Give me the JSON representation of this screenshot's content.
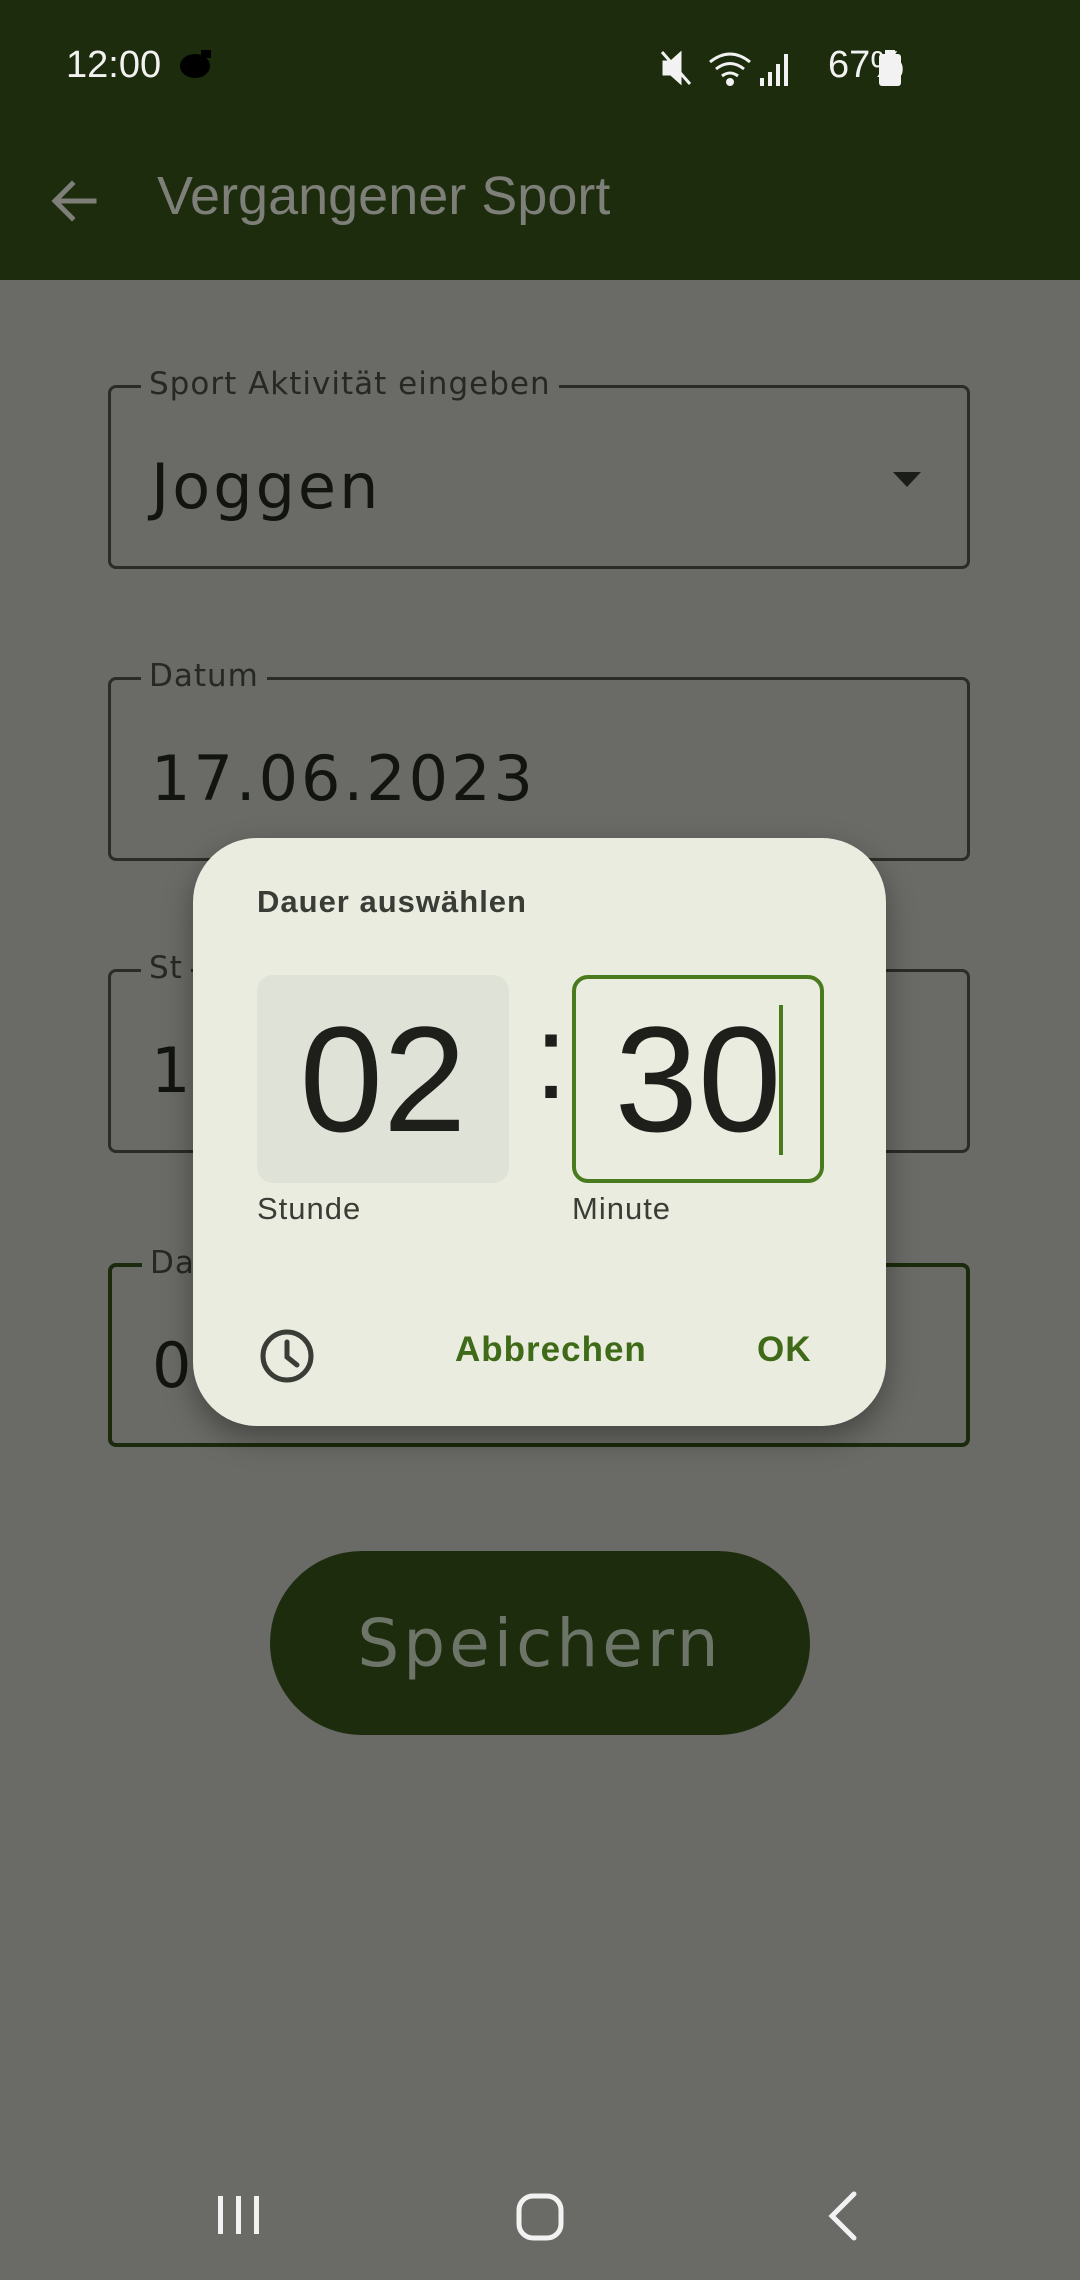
{
  "status_bar": {
    "time": "12:00",
    "battery": "67%",
    "icons": [
      "mute-icon",
      "wifi-icon",
      "signal-icon",
      "battery-icon"
    ]
  },
  "app_bar": {
    "title": "Vergangener Sport",
    "back_icon": "arrow-left-icon"
  },
  "form": {
    "sport": {
      "label": "Sport Aktivität eingeben",
      "value": "Joggen"
    },
    "date": {
      "label": "Datum",
      "value": "17.06.2023"
    },
    "start": {
      "label": "St",
      "value": "13"
    },
    "duration": {
      "label": "Da",
      "value": "0"
    },
    "save_label": "Speichern"
  },
  "dialog": {
    "title": "Dauer auswählen",
    "hour": "02",
    "separator": ":",
    "minute": "30",
    "hour_label": "Stunde",
    "minute_label": "Minute",
    "cancel_label": "Abbrechen",
    "ok_label": "OK",
    "mode_icon": "clock-icon"
  },
  "colors": {
    "app_bar": "#1c2c0d",
    "scrim": "#6a6b66",
    "dialog_bg": "#e9ecdf",
    "accent": "#3f6a17"
  }
}
